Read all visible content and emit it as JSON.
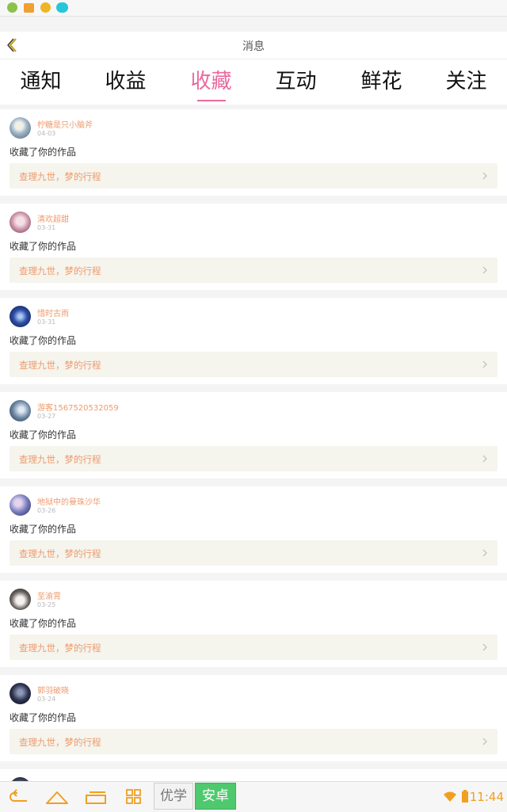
{
  "header": {
    "title": "消息"
  },
  "tabs": [
    {
      "label": "通知"
    },
    {
      "label": "收益"
    },
    {
      "label": "收藏",
      "active": true
    },
    {
      "label": "互动"
    },
    {
      "label": "鲜花"
    },
    {
      "label": "关注"
    }
  ],
  "messages": [
    {
      "user": "柠糖是只小脑斧",
      "date": "04-03",
      "action": "收藏了你的作品",
      "work": "查理九世，梦的行程"
    },
    {
      "user": "清欢超甜",
      "date": "03-31",
      "action": "收藏了你的作品",
      "work": "查理九世，梦的行程"
    },
    {
      "user": "惜时古雨",
      "date": "03-31",
      "action": "收藏了你的作品",
      "work": "查理九世，梦的行程"
    },
    {
      "user": "游客1567520532059",
      "date": "03-27",
      "action": "收藏了你的作品",
      "work": "查理九世，梦的行程"
    },
    {
      "user": "地狱中的曼珠沙华",
      "date": "03-26",
      "action": "收藏了你的作品",
      "work": "查理九世，梦的行程"
    },
    {
      "user": "至渝霄",
      "date": "03-25",
      "action": "收藏了你的作品",
      "work": "查理九世，梦的行程"
    },
    {
      "user": "郭羽破晓",
      "date": "03-24",
      "action": "收藏了你的作品",
      "work": "查理九世，梦的行程"
    }
  ],
  "nav": {
    "ime_left": "优学",
    "ime_right": "安卓",
    "time": "11:44"
  },
  "colors": {
    "accent_pink": "#e96a9f",
    "username_orange": "#ef9a6c",
    "ime_green": "#4fc96e",
    "clock_orange": "#f0a020"
  }
}
